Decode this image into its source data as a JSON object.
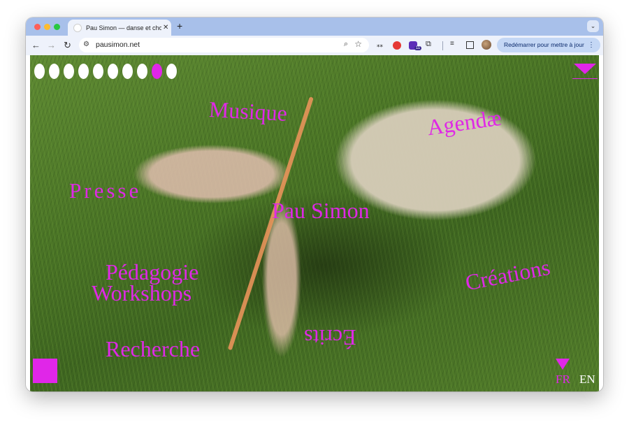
{
  "browser": {
    "tab_title": "Pau Simon — danse et chorégraphie",
    "tab_close": "✕",
    "new_tab": "+",
    "tab_menu": "⌄",
    "back": "←",
    "forward": "→",
    "reload": "↻",
    "url": "pausimon.net",
    "site_info_icon": "⚙",
    "zoom_icon": "⌕",
    "bookmark_icon": "☆",
    "ext_1": "⁎⁎",
    "ext_badge": "11",
    "ext_4": "⧉",
    "ext_5": "≡",
    "restart_label": "Redémarrer pour mettre à jour",
    "restart_menu": "⋮"
  },
  "site": {
    "slides": {
      "count": 10,
      "active_index": 8
    },
    "nav": {
      "musique": "Musique",
      "agendae": "Agendæ",
      "presse": "Presse",
      "pau_simon": "Pau Simon",
      "pedagogie": "Pédagogie",
      "workshops": "Workshops",
      "creations": "Créations",
      "ecrits": "Écrits",
      "recherche": "Recherche"
    },
    "lang": {
      "fr": "FR",
      "en": "EN"
    }
  },
  "colors": {
    "accent": "#e026e8",
    "tabbar": "#a8c0ea",
    "toolbar": "#eef2fb"
  }
}
